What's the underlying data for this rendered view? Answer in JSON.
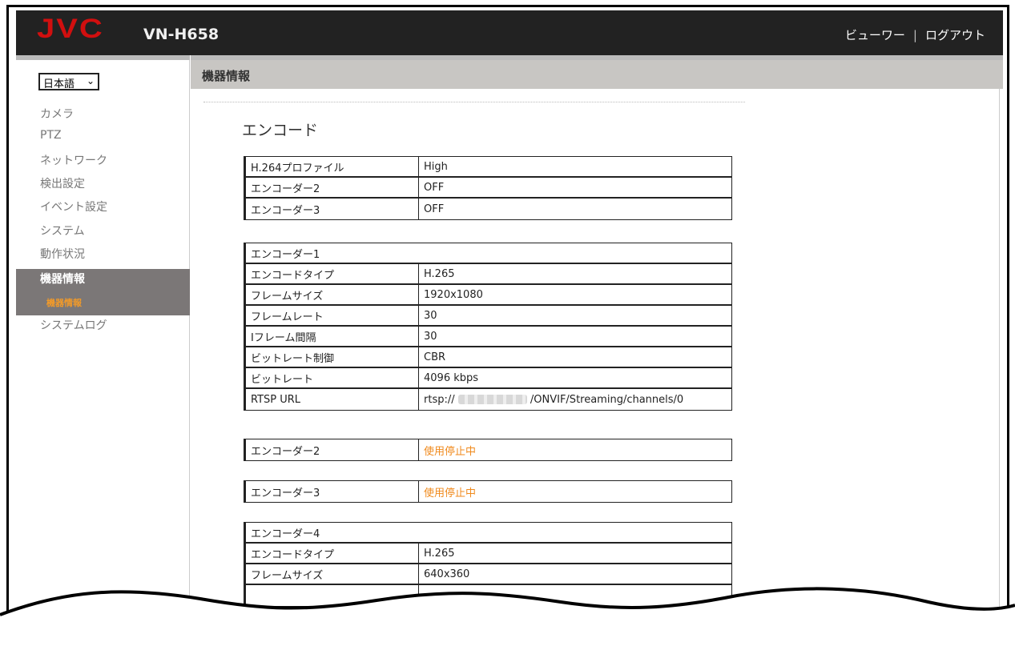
{
  "header": {
    "logo": "JVC",
    "model": "VN-H658",
    "viewer_link": "ビューワー",
    "separator": "|",
    "logout_link": "ログアウト"
  },
  "sidebar": {
    "language": "日本語",
    "items": [
      "カメラ",
      "PTZ",
      "ネットワーク",
      "検出設定",
      "イベント設定",
      "システム",
      "動作状況"
    ],
    "active": {
      "label": "機器情報",
      "sub": "機器情報"
    },
    "after": "システムログ"
  },
  "content": {
    "bar_title": "機器情報",
    "section_title": "エンコード",
    "table_general": [
      [
        "H.264プロファイル",
        "High"
      ],
      [
        "エンコーダー2",
        "OFF"
      ],
      [
        "エンコーダー3",
        "OFF"
      ]
    ],
    "enc1": {
      "header": "エンコーダー1",
      "rows": [
        [
          "エンコードタイプ",
          "H.265"
        ],
        [
          "フレームサイズ",
          "1920x1080"
        ],
        [
          "フレームレート",
          "30"
        ],
        [
          "Iフレーム間隔",
          "30"
        ],
        [
          "ビットレート制御",
          "CBR"
        ],
        [
          "ビットレート",
          "4096 kbps"
        ]
      ],
      "rtsp_label": "RTSP URL",
      "rtsp_prefix": "rtsp://",
      "rtsp_suffix": "/ONVIF/Streaming/channels/0"
    },
    "enc2": {
      "label": "エンコーダー2",
      "status": "使用停止中"
    },
    "enc3": {
      "label": "エンコーダー3",
      "status": "使用停止中"
    },
    "enc4": {
      "header": "エンコーダー4",
      "rows": [
        [
          "エンコードタイプ",
          "H.265"
        ],
        [
          "フレームサイズ",
          "640x360"
        ]
      ]
    }
  },
  "colors": {
    "logo_red": "#d10f0f",
    "header_bg": "#222222",
    "active_bg": "#7b7777",
    "accent_orange": "#f08a1c"
  }
}
